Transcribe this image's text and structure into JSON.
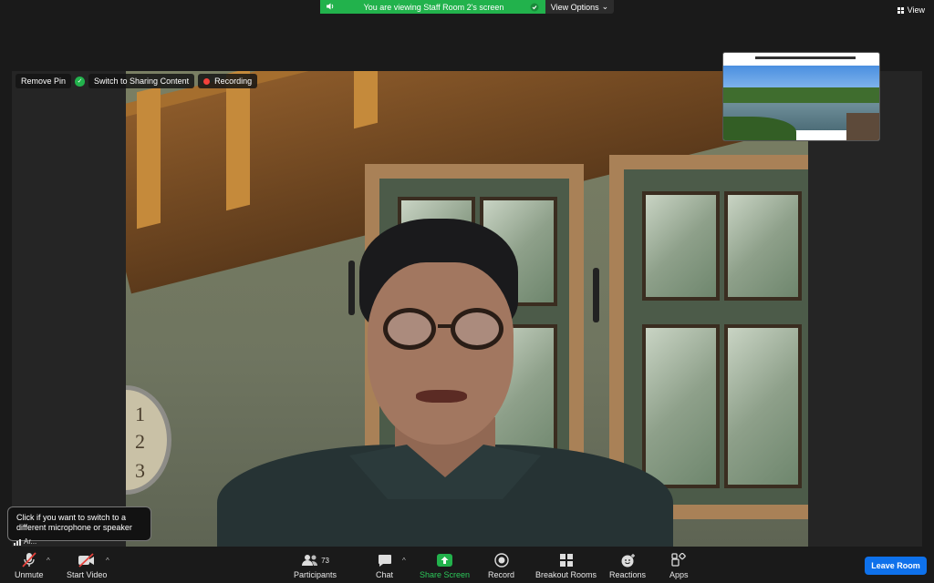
{
  "banner": {
    "text": "You are viewing Staff Room 2's screen",
    "view_options": "View Options",
    "view": "View"
  },
  "stage": {
    "remove_pin": "Remove Pin",
    "switch_sharing": "Switch to Sharing Content",
    "recording": "Recording"
  },
  "tooltip": {
    "text": "Click if you want to switch to a different microphone or speaker"
  },
  "speaker_label": "Ar...",
  "toolbar": {
    "unmute": "Unmute",
    "start_video": "Start Video",
    "participants": "Participants",
    "participants_count": "73",
    "chat": "Chat",
    "share_screen": "Share Screen",
    "record": "Record",
    "breakout_rooms": "Breakout Rooms",
    "reactions": "Reactions",
    "apps": "Apps",
    "leave_room": "Leave Room"
  },
  "colors": {
    "share_green": "#22b24c",
    "leave_blue": "#0e71eb",
    "recording_red": "#f5413b",
    "mute_red": "#e5413b"
  }
}
